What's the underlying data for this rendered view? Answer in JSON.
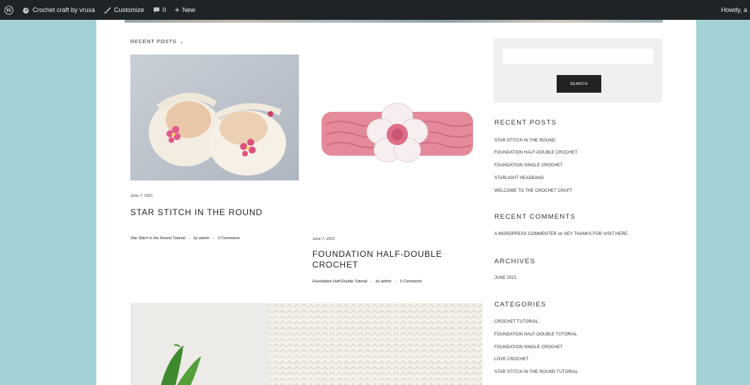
{
  "adminbar": {
    "site_name": "Crochet craft by vruxa",
    "customize": "Customize",
    "comments_count": "0",
    "new_label": "New",
    "howdy": "Howdy, a"
  },
  "content": {
    "section_label": "RECENT POSTS",
    "posts": [
      {
        "date": "June 7, 2021",
        "title": "STAR STITCH IN THE ROUND",
        "category": "Star Stitch in the Round Tutorial",
        "author": "by admin",
        "comments": "0 Comments"
      },
      {
        "date": "June 7, 2021",
        "title": "FOUNDATION HALF-DOUBLE CROCHET",
        "category": "Foundation Half-Double Tutorial",
        "author": "by admin",
        "comments": "0 Comments"
      }
    ],
    "separator": "-"
  },
  "sidebar": {
    "search": {
      "placeholder": "",
      "button": "SEARCH"
    },
    "recent_posts": {
      "title": "RECENT POSTS",
      "items": [
        "STAR STITCH IN THE ROUND",
        "FOUNDATION HALF-DOUBLE CROCHET",
        "FOUNDATION SINGLE CROCHET",
        "STARLIGHT HEADBAND",
        "WELCOME TO THE CROCHET CRAFT"
      ]
    },
    "recent_comments": {
      "title": "RECENT COMMENTS",
      "author": "A WORDPRESS COMMENTER",
      "on": "on",
      "post": "HEY THANKS FOR VISIT HERE."
    },
    "archives": {
      "title": "ARCHIVES",
      "items": [
        "JUNE 2021"
      ]
    },
    "categories": {
      "title": "CATEGORIES",
      "items": [
        "CROCHET TUTORIAL",
        "FOUNDATION HALF-DOUBLE TUTORIAL",
        "FOUNDATION SINGLE CROCHET",
        "LOVE CROCHET",
        "STAR STITCH IN THE ROUND TUTORIAL"
      ]
    }
  },
  "colors": {
    "adminbar_bg": "#1d2327",
    "page_bg": "#a3d2d6",
    "button_bg": "#222222"
  }
}
